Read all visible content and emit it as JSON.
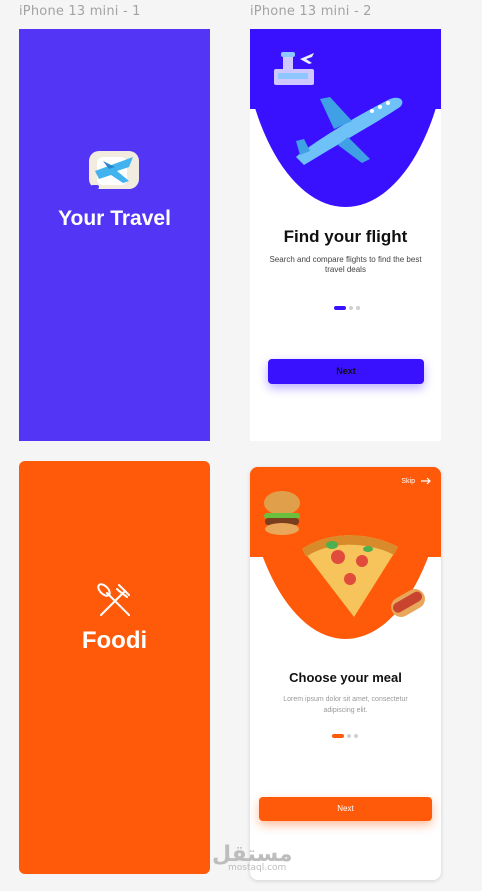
{
  "frames": {
    "splash_travel": {
      "label": "iPhone 13 mini - 1",
      "title": "Your Travel",
      "color": "#5336f5"
    },
    "onboarding_travel": {
      "label": "iPhone 13 mini - 2",
      "title": "Find your flight",
      "subtitle": "Search and compare flights to find the best travel deals",
      "button": "Next",
      "color": "#3a11ff",
      "pager": {
        "count": 3,
        "active": 1
      }
    },
    "splash_food": {
      "title": "Foodi",
      "color": "#ff5a0a"
    },
    "onboarding_food": {
      "skip": "Skip",
      "title": "Choose your meal",
      "subtitle": "Lorem ipsum dolor sit amet, consectetur adipiscing elit.",
      "button": "Next",
      "color": "#ff5a0a",
      "pager": {
        "count": 3,
        "active": 1
      }
    }
  },
  "watermark": {
    "text": "مستقل",
    "sub": "mostaql.com"
  }
}
